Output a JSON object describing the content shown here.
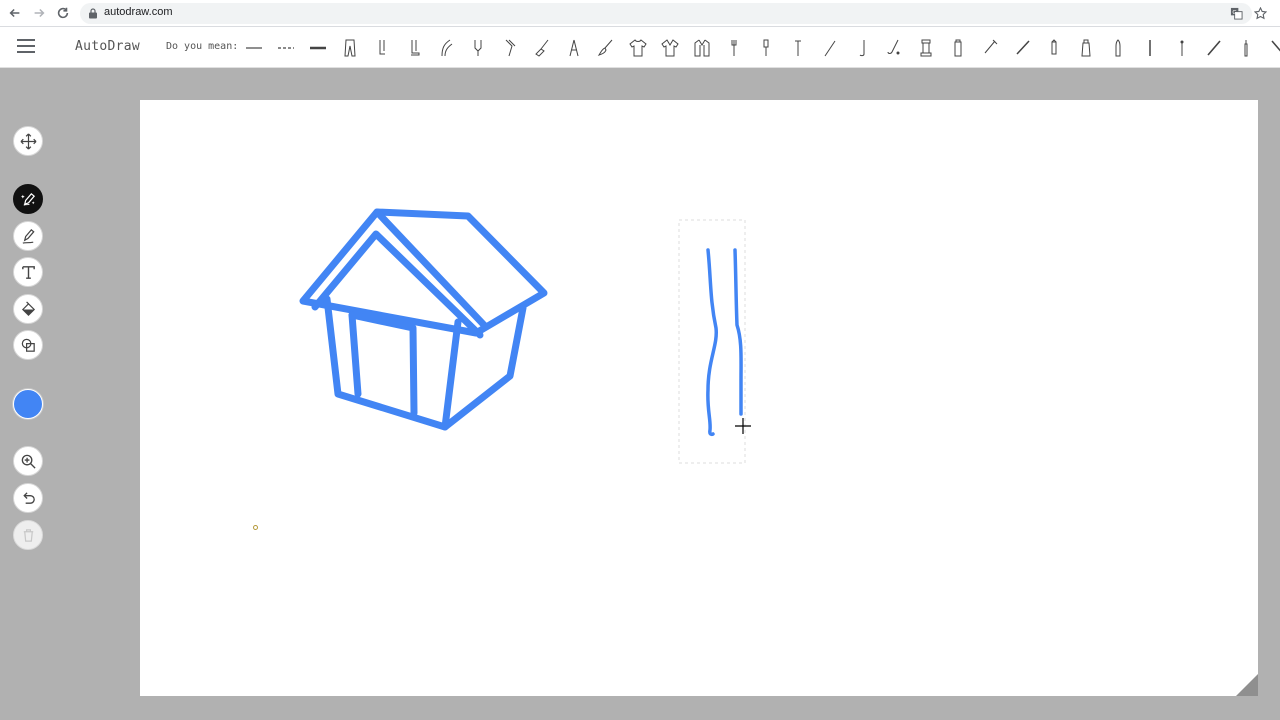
{
  "browser": {
    "url": "autodraw.com",
    "icons": [
      "back-icon",
      "forward-icon",
      "reload-icon",
      "lock-icon",
      "translate-icon",
      "star-icon"
    ]
  },
  "header": {
    "app_title": "AutoDraw",
    "suggest_label": "Do you mean:",
    "suggestions": [
      "line",
      "dashed-line",
      "thick-line",
      "pants",
      "leg",
      "boot",
      "arm",
      "tuning-fork",
      "knee",
      "broom",
      "eiffel-tower",
      "paintbrush",
      "t-shirt",
      "shirt",
      "jacket",
      "fork",
      "screwdriver",
      "nail",
      "wand",
      "hockey-stick",
      "golf-club",
      "chess-piece",
      "battery",
      "bolt",
      "spatula",
      "pencil",
      "lighthouse",
      "bullet",
      "pole",
      "pin",
      "baton",
      "candle",
      "stick",
      "brain"
    ]
  },
  "toolbar": {
    "tools": [
      {
        "name": "move-tool",
        "icon": "move-icon",
        "active": false
      },
      {
        "name": "autodraw-tool",
        "icon": "autodraw-icon",
        "active": true
      },
      {
        "name": "draw-tool",
        "icon": "pencil-icon",
        "active": false
      },
      {
        "name": "type-tool",
        "icon": "text-icon",
        "active": false
      },
      {
        "name": "fill-tool",
        "icon": "fill-bucket-icon",
        "active": false
      },
      {
        "name": "shape-tool",
        "icon": "shape-icon",
        "active": false
      },
      {
        "name": "zoom-tool",
        "icon": "zoom-in-icon",
        "active": false
      },
      {
        "name": "undo-tool",
        "icon": "undo-icon",
        "active": false
      },
      {
        "name": "delete-tool",
        "icon": "trash-icon",
        "active": false,
        "disabled": true
      }
    ],
    "current_color": "#4285f4"
  },
  "colors": {
    "stroke": "#4285f4",
    "canvas_bg": "#ffffff",
    "workspace_bg": "#b1b1b1"
  }
}
